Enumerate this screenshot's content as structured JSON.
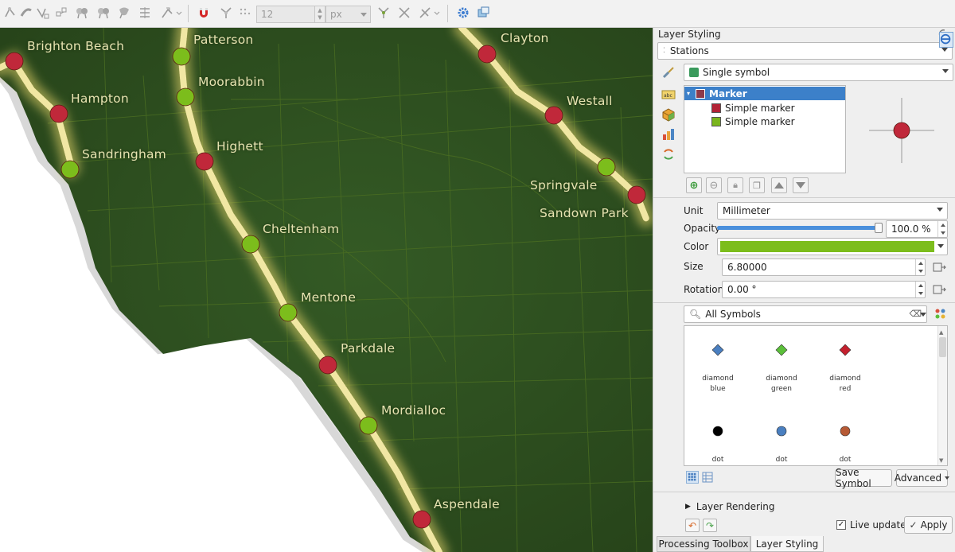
{
  "toolbar": {
    "size_value": "12",
    "unit_value": "px",
    "icons": [
      "vertex-tool-icon",
      "node-tool-icon",
      "split-features-icon",
      "merge-features-icon",
      "offset-curve-icon",
      "reshape-icon",
      "simplify-icon",
      "rotate-label-icon",
      "align-icon",
      "digitize-icon",
      "snapping-magnet-icon",
      "topology-icon",
      "tracing-icon",
      "trim-icon",
      "split-parts-icon",
      "delete-part-icon",
      "settings-gear-icon",
      "layer-window-icon"
    ]
  },
  "map": {
    "land_color": "#2b4d1d",
    "water_color": "#ffffff",
    "line_glow_color": "#e8d76a",
    "marker_red": "#c0283a",
    "marker_green": "#7cbd1c",
    "stations": [
      {
        "name": "Brighton Beach",
        "color": "red"
      },
      {
        "name": "Hampton",
        "color": "red"
      },
      {
        "name": "Sandringham",
        "color": "green"
      },
      {
        "name": "Patterson",
        "color": "green"
      },
      {
        "name": "Moorabbin",
        "color": "green"
      },
      {
        "name": "Highett",
        "color": "red"
      },
      {
        "name": "Cheltenham",
        "color": "green"
      },
      {
        "name": "Mentone",
        "color": "green"
      },
      {
        "name": "Parkdale",
        "color": "red"
      },
      {
        "name": "Mordialloc",
        "color": "green"
      },
      {
        "name": "Aspendale",
        "color": "red"
      },
      {
        "name": "Clayton",
        "color": "red"
      },
      {
        "name": "Westall",
        "color": "red"
      },
      {
        "name": "Springvale",
        "color": "green"
      },
      {
        "name": "Sandown Park",
        "color": "red"
      }
    ]
  },
  "panel": {
    "title": "Layer Styling",
    "layer": "Stations",
    "renderer": "Single symbol",
    "tree": {
      "root": "Marker",
      "children": [
        "Simple marker",
        "Simple marker"
      ],
      "child_colors": [
        "#b32336",
        "#7ab51d"
      ]
    },
    "preview_color": "#c0283a",
    "unit_label": "Unit",
    "unit_value": "Millimeter",
    "opacity_label": "Opacity",
    "opacity_value": "100.0 %",
    "opacity_fraction": 1.0,
    "color_label": "Color",
    "color_value": "#7cbd1c",
    "size_label": "Size",
    "size_value": "6.80000",
    "rotation_label": "Rotation",
    "rotation_value": "0.00 °",
    "search_value": "All Symbols",
    "symbols": [
      {
        "line1": "diamond",
        "line2": "blue",
        "shape": "diamond",
        "color": "#4a7fc0"
      },
      {
        "line1": "diamond",
        "line2": "green",
        "shape": "diamond",
        "color": "#5bbf3a"
      },
      {
        "line1": "diamond",
        "line2": "red",
        "shape": "diamond",
        "color": "#c4202e"
      },
      {
        "line1": "dot",
        "line2": "",
        "shape": "dot",
        "color": "#000000"
      },
      {
        "line1": "dot",
        "line2": "",
        "shape": "dot",
        "color": "#4a7fc0"
      },
      {
        "line1": "dot",
        "line2": "",
        "shape": "dot",
        "color": "#b65a35"
      }
    ],
    "save_symbol": "Save Symbol",
    "advanced": "Advanced",
    "layer_rendering": "Layer Rendering",
    "live_update": "Live update",
    "apply": "Apply",
    "tabs": [
      "Processing Toolbox",
      "Layer Styling"
    ]
  }
}
